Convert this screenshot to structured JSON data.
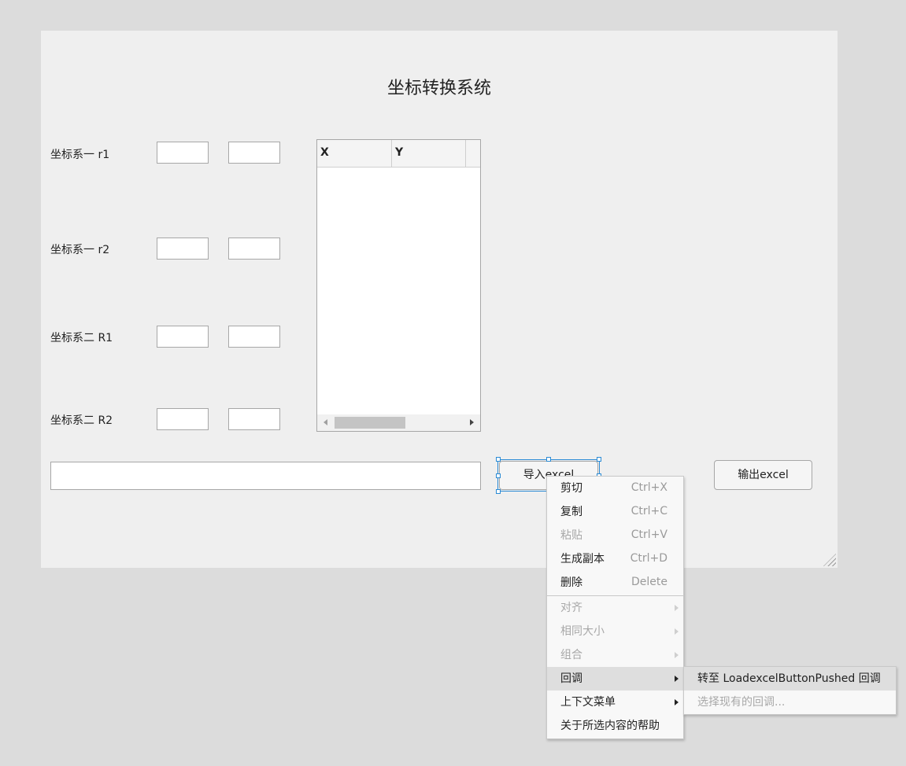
{
  "title": "坐标转换系统",
  "rows": [
    {
      "label": "坐标系一  r1"
    },
    {
      "label": "坐标系一  r2"
    },
    {
      "label": "坐标系二  R1"
    },
    {
      "label": "坐标系二  R2"
    }
  ],
  "table": {
    "columns": [
      "X",
      "Y"
    ]
  },
  "buttons": {
    "import": "导入excel",
    "export": "输出excel"
  },
  "context_menu": {
    "items": [
      {
        "label": "剪切",
        "shortcut": "Ctrl+X",
        "enabled": true
      },
      {
        "label": "复制",
        "shortcut": "Ctrl+C",
        "enabled": true
      },
      {
        "label": "粘贴",
        "shortcut": "Ctrl+V",
        "enabled": false
      },
      {
        "label": "生成副本",
        "shortcut": "Ctrl+D",
        "enabled": true
      },
      {
        "label": "删除",
        "shortcut": "Delete",
        "enabled": true
      },
      {
        "label": "对齐",
        "enabled": false,
        "submenu": true
      },
      {
        "label": "相同大小",
        "enabled": false,
        "submenu": true
      },
      {
        "label": "组合",
        "enabled": false,
        "submenu": true
      },
      {
        "label": "回调",
        "enabled": true,
        "submenu": true,
        "highlighted": true
      },
      {
        "label": "上下文菜单",
        "enabled": true,
        "submenu": true
      },
      {
        "label": "关于所选内容的帮助",
        "enabled": true
      }
    ]
  },
  "submenu": {
    "items": [
      {
        "label": "转至 LoadexcelButtonPushed 回调",
        "enabled": true,
        "highlighted": true
      },
      {
        "label": "选择现有的回调...",
        "enabled": false
      }
    ]
  },
  "colors": {
    "selection": "#2a8ad4",
    "canvas": "#efefef",
    "background": "#dcdcdc"
  }
}
